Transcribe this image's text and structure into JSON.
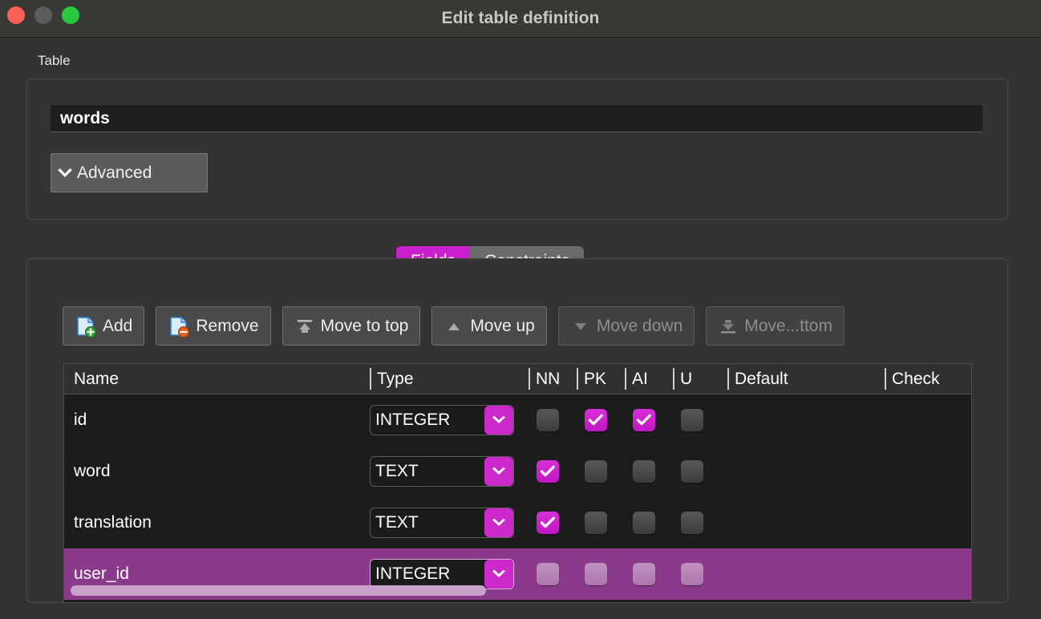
{
  "window": {
    "title": "Edit table definition",
    "controls": [
      {
        "name": "close",
        "color": "#ff5f57"
      },
      {
        "name": "minimize",
        "color": "#5c5c5c"
      },
      {
        "name": "maximize",
        "color": "#28c840"
      }
    ]
  },
  "table_section": {
    "group_label": "Table",
    "name_value": "words",
    "name_placeholder": "",
    "advanced_label": "Advanced",
    "advanced_icon": "chevron-down-icon"
  },
  "tabs": [
    {
      "label": "Fields",
      "active": true
    },
    {
      "label": "Constraints",
      "active": false
    }
  ],
  "toolbar": [
    {
      "label": "Add",
      "icon": "document-add-icon",
      "disabled": false
    },
    {
      "label": "Remove",
      "icon": "document-remove-icon",
      "disabled": false
    },
    {
      "label": "Move to top",
      "icon": "move-to-top-icon",
      "disabled": false
    },
    {
      "label": "Move up",
      "icon": "move-up-icon",
      "disabled": false
    },
    {
      "label": "Move down",
      "icon": "move-down-icon",
      "disabled": true
    },
    {
      "label": "Move...ttom",
      "icon": "move-to-bottom-icon",
      "disabled": true
    }
  ],
  "fields_table": {
    "columns": [
      "Name",
      "Type",
      "NN",
      "PK",
      "AI",
      "U",
      "Default",
      "Check"
    ],
    "rows": [
      {
        "name": "id",
        "type": "INTEGER",
        "nn": false,
        "pk": true,
        "ai": true,
        "u": false,
        "default": "",
        "check": "",
        "selected": false,
        "editing": false
      },
      {
        "name": "word",
        "type": "TEXT",
        "nn": true,
        "pk": false,
        "ai": false,
        "u": false,
        "default": "",
        "check": "",
        "selected": false,
        "editing": false
      },
      {
        "name": "translation",
        "type": "TEXT",
        "nn": true,
        "pk": false,
        "ai": false,
        "u": false,
        "default": "",
        "check": "",
        "selected": false,
        "editing": false
      },
      {
        "name": "user_id",
        "type": "INTEGER",
        "nn": false,
        "pk": false,
        "ai": false,
        "u": false,
        "default": "",
        "check": "",
        "selected": true,
        "editing": true
      }
    ]
  },
  "colors": {
    "accent": "#cc28cc",
    "selection": "#8b3a8b",
    "window_bg": "#333333",
    "titlebar_bg": "#383835",
    "table_bg": "#1c1c1c"
  }
}
